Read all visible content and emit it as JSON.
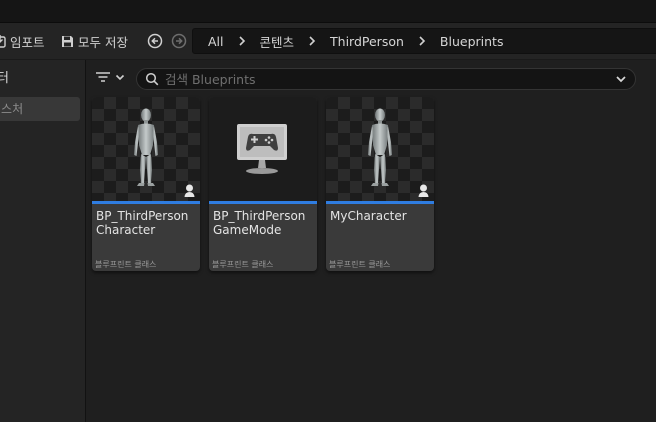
{
  "toolbar": {
    "import_label": "임포트",
    "save_all_label": "모두 저장",
    "breadcrumbs": [
      "All",
      "콘텐츠",
      "ThirdPerson",
      "Blueprints"
    ]
  },
  "left_panel": {
    "header": "필터",
    "item": "텍스처"
  },
  "search": {
    "placeholder": "검색 Blueprints"
  },
  "assets": [
    {
      "name": "BP_ThirdPerson\nCharacter",
      "type": "블루프린트 클래스",
      "thumbnail": "mannequin-figure"
    },
    {
      "name": "BP_ThirdPerson\nGameMode",
      "type": "블루프린트 클래스",
      "thumbnail": "gamemode-monitor-icon"
    },
    {
      "name": "MyCharacter",
      "type": "블루프린트 클래스",
      "thumbnail": "mannequin-figure"
    }
  ],
  "colors": {
    "accent": "#2f7de1",
    "background": "#1a1a1a",
    "panel": "#242424",
    "card": "#3a3a3a"
  }
}
